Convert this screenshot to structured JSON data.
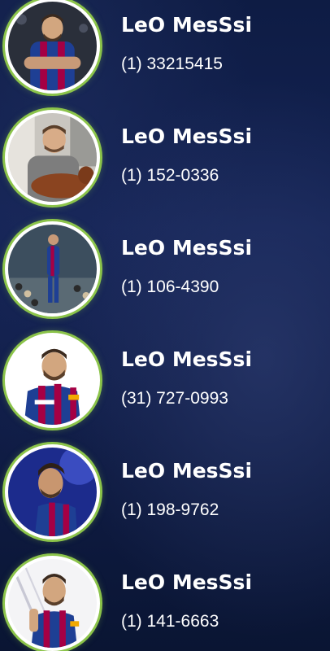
{
  "contacts": [
    {
      "name": "LeO MesSsi",
      "phone": "(1) 33215415",
      "photo": "messi-arms-crossed-photo"
    },
    {
      "name": "LeO MesSsi",
      "phone": "(1) 152-0336",
      "photo": "messi-with-dog-photo"
    },
    {
      "name": "LeO MesSsi",
      "phone": "(1) 106-4390",
      "photo": "messi-stadium-photo"
    },
    {
      "name": "LeO MesSsi",
      "phone": "(31) 727-0993",
      "photo": "messi-barca-jersey-photo"
    },
    {
      "name": "LeO MesSsi",
      "phone": "(1) 198-9762",
      "photo": "messi-profile-photo"
    },
    {
      "name": "LeO MesSsi",
      "phone": "(1) 141-6663",
      "photo": "messi-captain-photo"
    }
  ],
  "colors": {
    "background": "#101d47",
    "avatar_ring": "#8bc34a",
    "text": "#ffffff",
    "jersey_blue": "#1e3f94",
    "jersey_red": "#a50044"
  }
}
